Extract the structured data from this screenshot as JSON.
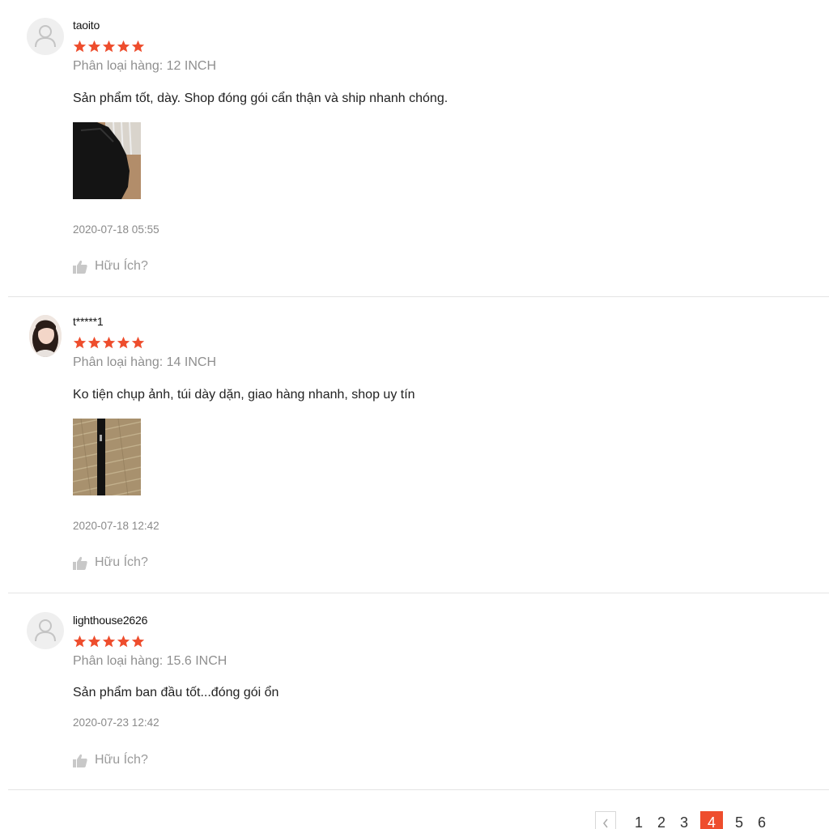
{
  "reviews": [
    {
      "username": "taoito",
      "rating": 5,
      "variant": "Phân loại hàng: 12 INCH",
      "comment": "Sản phẩm tốt, dày. Shop đóng gói cẩn thận và ship nhanh chóng.",
      "date": "2020-07-18 05:55",
      "helpful_label": "Hữu Ích?"
    },
    {
      "username": "t*****1",
      "rating": 5,
      "variant": "Phân loại hàng: 14 INCH",
      "comment": "Ko tiện chụp ảnh, túi dày dặn, giao hàng nhanh, shop uy tín",
      "date": "2020-07-18 12:42",
      "helpful_label": "Hữu Ích?"
    },
    {
      "username": "lighthouse2626",
      "rating": 5,
      "variant": "Phân loại hàng: 15.6 INCH",
      "comment": "Sản phẩm ban đầu tốt...đóng gói ổn",
      "date": "2020-07-23 12:42",
      "helpful_label": "Hữu Ích?"
    }
  ],
  "pagination": {
    "prev": "<",
    "pages": [
      "1",
      "2",
      "3",
      "4",
      "5",
      "6"
    ],
    "current": "4"
  },
  "colors": {
    "star": "#ee4d2d",
    "accent": "#ee4d2d"
  },
  "icons": {
    "avatar_placeholder": "user-icon",
    "star": "star-icon",
    "helpful": "thumbs-up-icon",
    "prev": "chevron-left-icon"
  }
}
